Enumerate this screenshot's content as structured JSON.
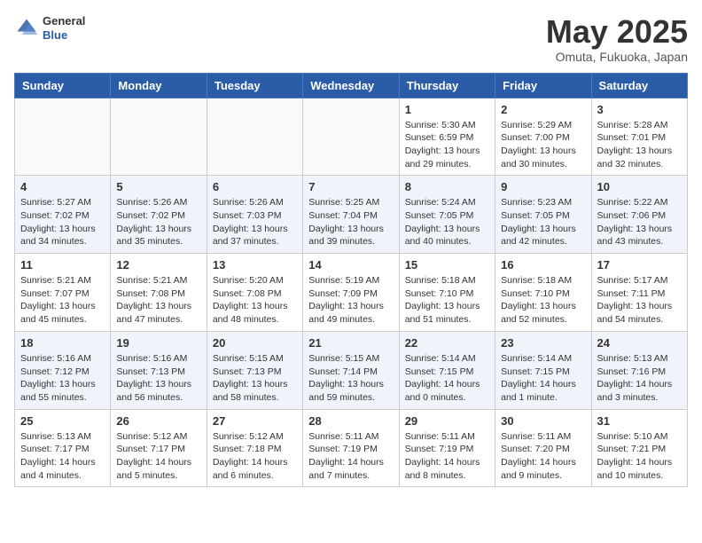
{
  "header": {
    "logo_general": "General",
    "logo_blue": "Blue",
    "month_title": "May 2025",
    "subtitle": "Omuta, Fukuoka, Japan"
  },
  "weekdays": [
    "Sunday",
    "Monday",
    "Tuesday",
    "Wednesday",
    "Thursday",
    "Friday",
    "Saturday"
  ],
  "weeks": [
    [
      {
        "day": "",
        "info": ""
      },
      {
        "day": "",
        "info": ""
      },
      {
        "day": "",
        "info": ""
      },
      {
        "day": "",
        "info": ""
      },
      {
        "day": "1",
        "info": "Sunrise: 5:30 AM\nSunset: 6:59 PM\nDaylight: 13 hours\nand 29 minutes."
      },
      {
        "day": "2",
        "info": "Sunrise: 5:29 AM\nSunset: 7:00 PM\nDaylight: 13 hours\nand 30 minutes."
      },
      {
        "day": "3",
        "info": "Sunrise: 5:28 AM\nSunset: 7:01 PM\nDaylight: 13 hours\nand 32 minutes."
      }
    ],
    [
      {
        "day": "4",
        "info": "Sunrise: 5:27 AM\nSunset: 7:02 PM\nDaylight: 13 hours\nand 34 minutes."
      },
      {
        "day": "5",
        "info": "Sunrise: 5:26 AM\nSunset: 7:02 PM\nDaylight: 13 hours\nand 35 minutes."
      },
      {
        "day": "6",
        "info": "Sunrise: 5:26 AM\nSunset: 7:03 PM\nDaylight: 13 hours\nand 37 minutes."
      },
      {
        "day": "7",
        "info": "Sunrise: 5:25 AM\nSunset: 7:04 PM\nDaylight: 13 hours\nand 39 minutes."
      },
      {
        "day": "8",
        "info": "Sunrise: 5:24 AM\nSunset: 7:05 PM\nDaylight: 13 hours\nand 40 minutes."
      },
      {
        "day": "9",
        "info": "Sunrise: 5:23 AM\nSunset: 7:05 PM\nDaylight: 13 hours\nand 42 minutes."
      },
      {
        "day": "10",
        "info": "Sunrise: 5:22 AM\nSunset: 7:06 PM\nDaylight: 13 hours\nand 43 minutes."
      }
    ],
    [
      {
        "day": "11",
        "info": "Sunrise: 5:21 AM\nSunset: 7:07 PM\nDaylight: 13 hours\nand 45 minutes."
      },
      {
        "day": "12",
        "info": "Sunrise: 5:21 AM\nSunset: 7:08 PM\nDaylight: 13 hours\nand 47 minutes."
      },
      {
        "day": "13",
        "info": "Sunrise: 5:20 AM\nSunset: 7:08 PM\nDaylight: 13 hours\nand 48 minutes."
      },
      {
        "day": "14",
        "info": "Sunrise: 5:19 AM\nSunset: 7:09 PM\nDaylight: 13 hours\nand 49 minutes."
      },
      {
        "day": "15",
        "info": "Sunrise: 5:18 AM\nSunset: 7:10 PM\nDaylight: 13 hours\nand 51 minutes."
      },
      {
        "day": "16",
        "info": "Sunrise: 5:18 AM\nSunset: 7:10 PM\nDaylight: 13 hours\nand 52 minutes."
      },
      {
        "day": "17",
        "info": "Sunrise: 5:17 AM\nSunset: 7:11 PM\nDaylight: 13 hours\nand 54 minutes."
      }
    ],
    [
      {
        "day": "18",
        "info": "Sunrise: 5:16 AM\nSunset: 7:12 PM\nDaylight: 13 hours\nand 55 minutes."
      },
      {
        "day": "19",
        "info": "Sunrise: 5:16 AM\nSunset: 7:13 PM\nDaylight: 13 hours\nand 56 minutes."
      },
      {
        "day": "20",
        "info": "Sunrise: 5:15 AM\nSunset: 7:13 PM\nDaylight: 13 hours\nand 58 minutes."
      },
      {
        "day": "21",
        "info": "Sunrise: 5:15 AM\nSunset: 7:14 PM\nDaylight: 13 hours\nand 59 minutes."
      },
      {
        "day": "22",
        "info": "Sunrise: 5:14 AM\nSunset: 7:15 PM\nDaylight: 14 hours\nand 0 minutes."
      },
      {
        "day": "23",
        "info": "Sunrise: 5:14 AM\nSunset: 7:15 PM\nDaylight: 14 hours\nand 1 minute."
      },
      {
        "day": "24",
        "info": "Sunrise: 5:13 AM\nSunset: 7:16 PM\nDaylight: 14 hours\nand 3 minutes."
      }
    ],
    [
      {
        "day": "25",
        "info": "Sunrise: 5:13 AM\nSunset: 7:17 PM\nDaylight: 14 hours\nand 4 minutes."
      },
      {
        "day": "26",
        "info": "Sunrise: 5:12 AM\nSunset: 7:17 PM\nDaylight: 14 hours\nand 5 minutes."
      },
      {
        "day": "27",
        "info": "Sunrise: 5:12 AM\nSunset: 7:18 PM\nDaylight: 14 hours\nand 6 minutes."
      },
      {
        "day": "28",
        "info": "Sunrise: 5:11 AM\nSunset: 7:19 PM\nDaylight: 14 hours\nand 7 minutes."
      },
      {
        "day": "29",
        "info": "Sunrise: 5:11 AM\nSunset: 7:19 PM\nDaylight: 14 hours\nand 8 minutes."
      },
      {
        "day": "30",
        "info": "Sunrise: 5:11 AM\nSunset: 7:20 PM\nDaylight: 14 hours\nand 9 minutes."
      },
      {
        "day": "31",
        "info": "Sunrise: 5:10 AM\nSunset: 7:21 PM\nDaylight: 14 hours\nand 10 minutes."
      }
    ]
  ]
}
